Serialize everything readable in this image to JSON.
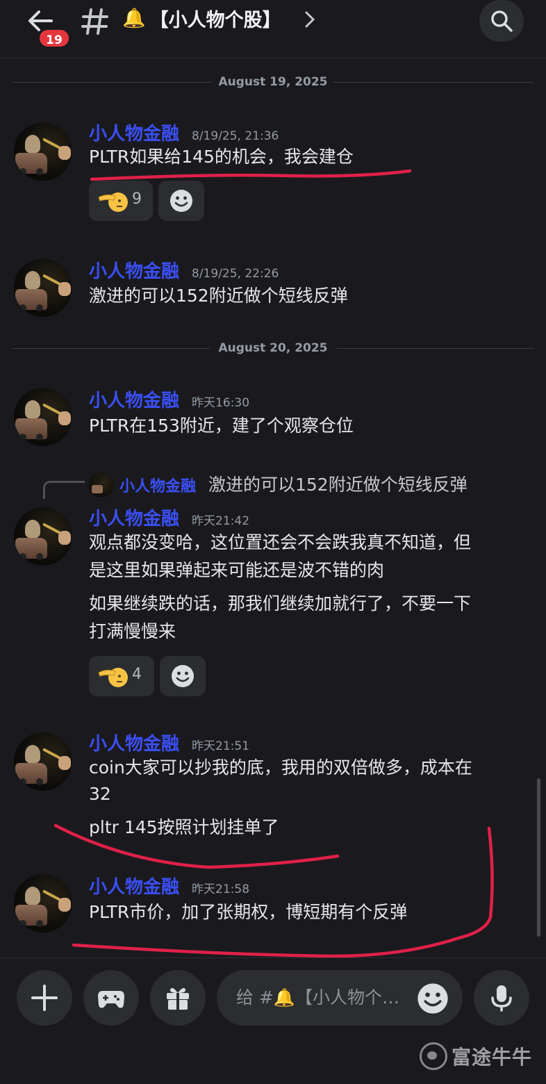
{
  "header": {
    "unread_count": "19",
    "channel_name": "【小人物个股】",
    "channel_emoji": "🔔"
  },
  "dividers": [
    "August 19, 2025",
    "August 20, 2025"
  ],
  "messages": [
    {
      "author": "小人物金融",
      "time": "8/19/25, 21:36",
      "lines": [
        "PLTR如果给145的机会，我会建仓"
      ],
      "reaction": {
        "emoji": "salute-emoji",
        "count": "9"
      }
    },
    {
      "author": "小人物金融",
      "time": "8/19/25, 22:26",
      "lines": [
        "激进的可以152附近做个短线反弹"
      ]
    },
    {
      "author": "小人物金融",
      "time": "昨天16:30",
      "lines": [
        "PLTR在153附近，建了个观察仓位"
      ]
    },
    {
      "author": "小人物金融",
      "time": "昨天21:42",
      "reply_to": {
        "author": "小人物金融",
        "text": "激进的可以152附近做个短线反弹"
      },
      "lines": [
        "观点都没变哈，这位置还会不会跌我真不知道，但",
        "是这里如果弹起来可能还是波不错的肉"
      ],
      "lines2": [
        "如果继续跌的话，那我们继续加就行了，不要一下",
        "打满慢慢来"
      ],
      "reaction": {
        "emoji": "salute-emoji",
        "count": "4"
      }
    },
    {
      "author": "小人物金融",
      "time": "昨天21:51",
      "lines": [
        "coin大家可以抄我的底，我用的双倍做多，成本在",
        "32"
      ],
      "lines2": [
        "pltr 145按照计划挂单了"
      ]
    },
    {
      "author": "小人物金融",
      "time": "昨天21:58",
      "lines": [
        "PLTR市价，加了张期权，博短期有个反弹"
      ]
    }
  ],
  "composer": {
    "placeholder": "给 #🔔【小人物个…",
    "buttons": [
      "plus-icon",
      "gamepad-icon",
      "gift-icon",
      "emoji-icon",
      "mic-icon"
    ]
  },
  "watermark": "富途牛牛",
  "colors": {
    "background": "#1a1a1e",
    "author": "#3b4ff5",
    "badge": "#e5363d",
    "annotation": "#e0204a"
  }
}
